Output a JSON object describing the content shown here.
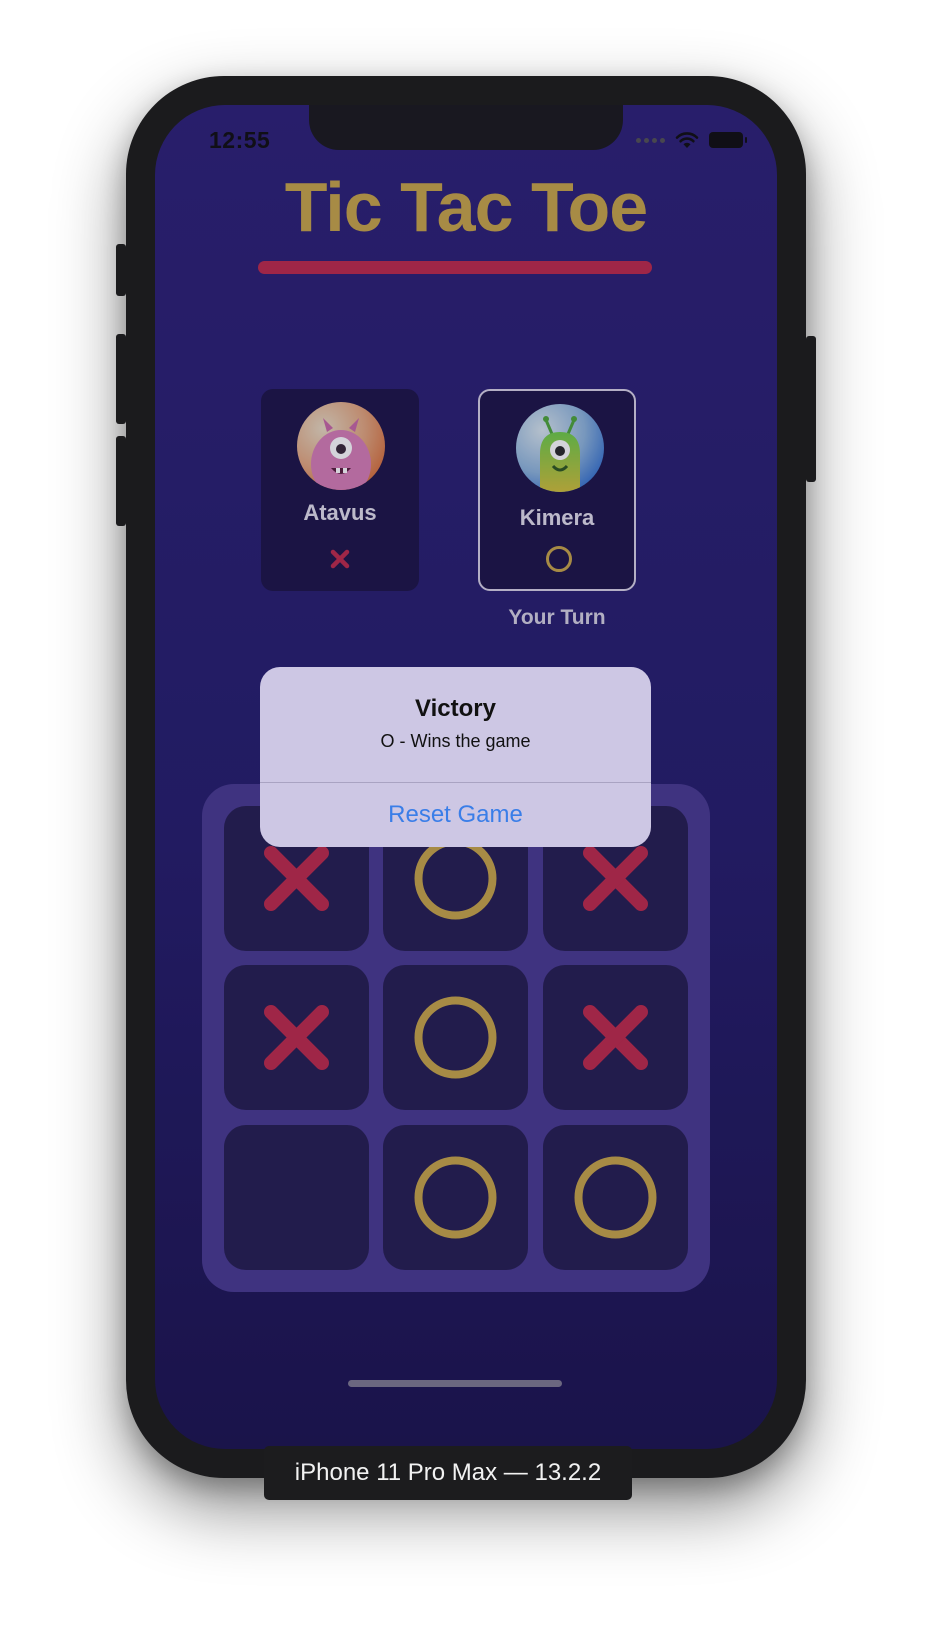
{
  "status_bar": {
    "time": "12:55"
  },
  "app": {
    "title": "Tic Tac Toe",
    "colors": {
      "x_mark": "#bf2c4c",
      "o_mark": "#c9a84a",
      "title": "#c9a84a"
    }
  },
  "players": [
    {
      "name": "Atavus",
      "mark": "X",
      "avatar_icon": "pink-monster-avatar",
      "active": false
    },
    {
      "name": "Kimera",
      "mark": "O",
      "avatar_icon": "green-monster-avatar",
      "active": true
    }
  ],
  "turn_label": "Your Turn",
  "board": {
    "cells": [
      "X",
      "O",
      "X",
      "X",
      "O",
      "X",
      "",
      "O",
      "O"
    ]
  },
  "alert": {
    "title": "Victory",
    "message": "O - Wins the game",
    "action": "Reset Game"
  },
  "device_label": "iPhone 11 Pro Max — 13.2.2"
}
